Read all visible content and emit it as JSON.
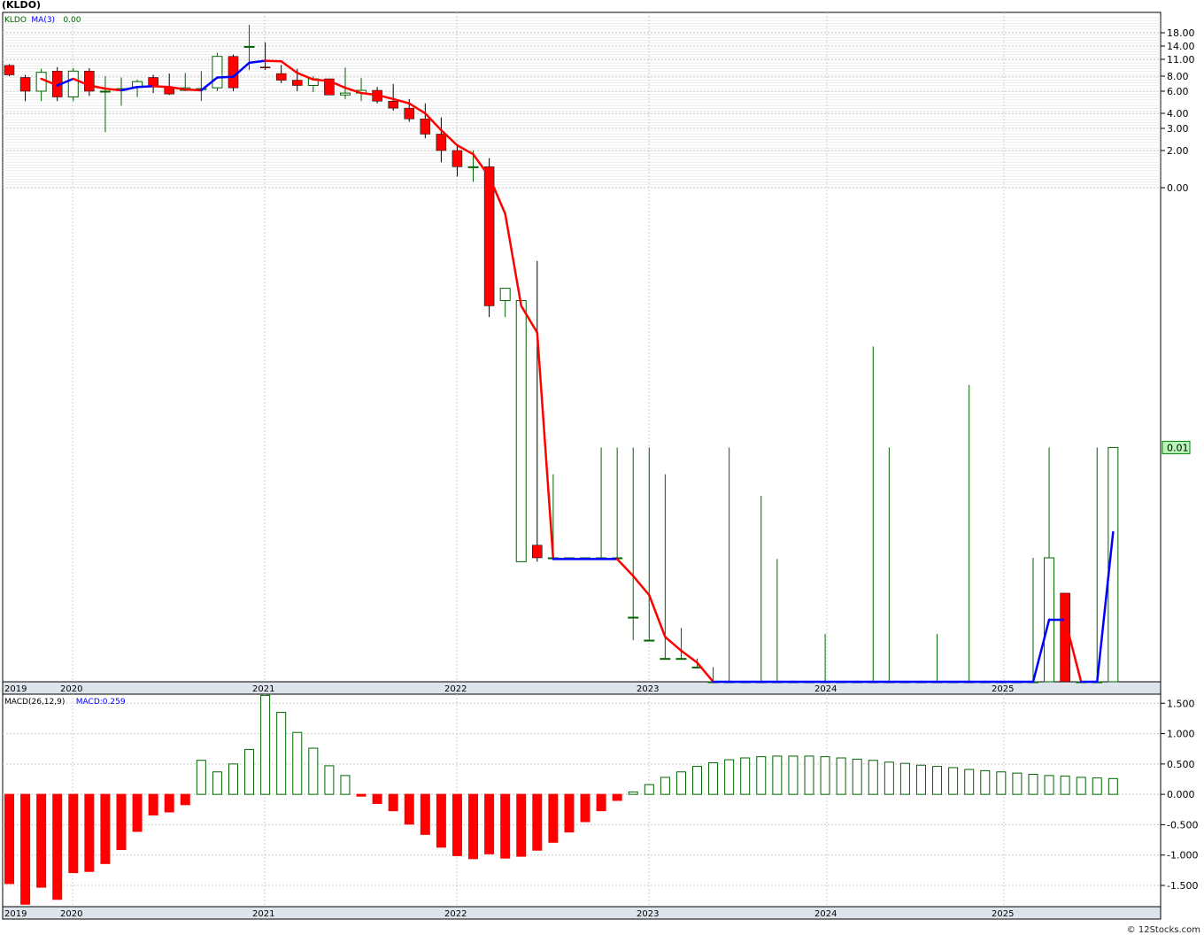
{
  "title": "(KLDO)",
  "credit": "© 12Stocks.com",
  "colors": {
    "up": "#006400",
    "down": "#ff0000",
    "ma_up": "#0000ff",
    "ma_down": "#ff0000",
    "grid": "#cccccc",
    "axis_band": "#dde4ec",
    "last_price_bg": "#b8f5b8"
  },
  "chart_data": [
    {
      "type": "candlestick",
      "name": "price",
      "legend": [
        {
          "label": "KLDO",
          "color": "#006400"
        },
        {
          "label": "MA(3)",
          "color": "#0000ff"
        },
        {
          "label": "0.00",
          "color": "#006400"
        }
      ],
      "scale": "log",
      "y_ticks": [
        "18.00",
        "14.00",
        "11.00",
        "8.00",
        "6.00",
        "4.00",
        "3.00",
        "2.00",
        "0.00"
      ],
      "last_price_label": "0.01",
      "x_tick_labels": [
        "2019",
        "2020",
        "2021",
        "2022",
        "2023",
        "2024",
        "2025"
      ],
      "months": [
        "2019-11",
        "2019-12",
        "2020-01",
        "2020-02",
        "2020-03",
        "2020-04",
        "2020-05",
        "2020-06",
        "2020-07",
        "2020-08",
        "2020-09",
        "2020-10",
        "2020-11",
        "2020-12",
        "2021-01",
        "2021-02",
        "2021-03",
        "2021-04",
        "2021-05",
        "2021-06",
        "2021-07",
        "2021-08",
        "2021-09",
        "2021-10",
        "2021-11",
        "2021-12",
        "2022-01",
        "2022-02",
        "2022-03",
        "2022-04",
        "2022-05",
        "2022-06",
        "2022-07",
        "2022-08",
        "2022-09",
        "2022-10",
        "2022-11",
        "2022-12",
        "2023-01",
        "2023-02",
        "2023-03",
        "2023-04",
        "2023-05",
        "2023-06",
        "2023-07",
        "2023-08",
        "2023-09",
        "2023-10",
        "2023-11",
        "2023-12",
        "2024-01",
        "2024-02",
        "2024-03",
        "2024-04",
        "2024-05",
        "2024-06",
        "2024-07",
        "2024-08",
        "2024-09",
        "2024-10",
        "2024-11",
        "2024-12",
        "2025-01",
        "2025-02",
        "2025-03",
        "2025-04",
        "2025-05",
        "2025-06",
        "2025-07",
        "2025-08"
      ],
      "open": [
        9.8,
        7.8,
        6.0,
        8.8,
        5.4,
        8.8,
        6.0,
        6.1,
        6.5,
        7.8,
        6.5,
        6.1,
        6.3,
        6.4,
        11.6,
        13.9,
        9.5,
        8.4,
        7.4,
        6.7,
        7.6,
        5.6,
        5.8,
        6.1,
        5.0,
        4.4,
        3.6,
        2.7,
        2.0,
        1.6,
        1.6,
        0.5,
        0.065,
        0.075,
        0.068,
        0.068,
        0.068,
        0.068,
        0.068,
        0.034,
        0.026,
        0.021,
        0.021,
        0.019,
        0.016,
        0.016,
        0.016,
        0.016,
        0.016,
        0.016,
        0.016,
        0.016,
        0.016,
        0.016,
        0.016,
        0.016,
        0.016,
        0.016,
        0.016,
        0.016,
        0.016,
        0.016,
        0.016,
        0.016,
        0.016,
        0.016,
        0.045,
        0.016,
        0.016,
        0.016
      ],
      "high": [
        10.0,
        8.2,
        9.2,
        9.5,
        9.3,
        9.3,
        8.0,
        7.8,
        7.5,
        8.2,
        8.4,
        8.5,
        8.8,
        12.4,
        12.0,
        20.0,
        15.0,
        9.9,
        9.2,
        8.0,
        7.5,
        9.4,
        7.7,
        6.5,
        6.9,
        5.2,
        4.8,
        3.7,
        2.2,
        2.0,
        1.8,
        0.55,
        0.48,
        0.68,
        0.13,
        0.068,
        0.068,
        0.16,
        0.16,
        0.16,
        0.16,
        0.13,
        0.03,
        0.021,
        0.019,
        0.16,
        0.016,
        0.11,
        0.067,
        0.016,
        0.016,
        0.028,
        0.016,
        0.016,
        0.35,
        0.16,
        0.016,
        0.016,
        0.028,
        0.016,
        0.26,
        0.016,
        0.016,
        0.016,
        0.068,
        0.16,
        0.045,
        0.016,
        0.16,
        0.16
      ],
      "low": [
        8.0,
        5.0,
        5.0,
        5.0,
        5.0,
        5.5,
        2.8,
        4.6,
        5.4,
        5.8,
        5.6,
        6.0,
        5.0,
        6.0,
        6.0,
        9.0,
        9.0,
        7.0,
        6.0,
        5.9,
        5.6,
        5.2,
        5.0,
        4.8,
        4.2,
        3.4,
        2.5,
        1.7,
        1.4,
        1.3,
        0.44,
        0.44,
        0.065,
        0.065,
        0.068,
        0.068,
        0.068,
        0.068,
        0.068,
        0.026,
        0.026,
        0.021,
        0.021,
        0.019,
        0.016,
        0.016,
        0.016,
        0.016,
        0.016,
        0.016,
        0.016,
        0.016,
        0.016,
        0.016,
        0.016,
        0.016,
        0.016,
        0.016,
        0.016,
        0.016,
        0.016,
        0.016,
        0.016,
        0.016,
        0.016,
        0.016,
        0.016,
        0.016,
        0.016,
        0.016
      ],
      "close": [
        8.2,
        6.0,
        8.6,
        5.4,
        8.8,
        6.0,
        6.0,
        6.3,
        7.2,
        6.5,
        5.7,
        6.4,
        6.3,
        11.6,
        6.4,
        13.9,
        9.4,
        7.4,
        6.7,
        7.6,
        5.6,
        5.8,
        6.1,
        5.0,
        4.4,
        3.6,
        2.7,
        2.0,
        1.6,
        1.6,
        0.48,
        0.55,
        0.5,
        0.068,
        0.068,
        0.068,
        0.068,
        0.068,
        0.068,
        0.034,
        0.026,
        0.021,
        0.021,
        0.019,
        0.016,
        0.016,
        0.016,
        0.016,
        0.016,
        0.016,
        0.016,
        0.016,
        0.016,
        0.016,
        0.016,
        0.016,
        0.016,
        0.016,
        0.016,
        0.016,
        0.016,
        0.016,
        0.016,
        0.016,
        0.016,
        0.068,
        0.016,
        0.016,
        0.016,
        0.16
      ],
      "ma3": [
        null,
        null,
        7.6,
        6.7,
        7.6,
        6.7,
        6.3,
        6.1,
        6.5,
        6.6,
        6.5,
        6.2,
        6.1,
        7.8,
        7.9,
        10.3,
        10.7,
        10.6,
        8.5,
        7.5,
        7.3,
        6.4,
        5.8,
        5.6,
        5.2,
        4.8,
        4.0,
        2.9,
        2.2,
        1.9,
        1.4,
        0.98,
        0.48,
        0.39,
        0.067,
        0.067,
        0.067,
        0.067,
        0.067,
        0.055,
        0.044,
        0.027,
        0.023,
        0.02,
        0.016,
        0.016,
        0.016,
        0.016,
        0.016,
        0.016,
        0.016,
        0.016,
        0.016,
        0.016,
        0.016,
        0.016,
        0.016,
        0.016,
        0.016,
        0.016,
        0.016,
        0.016,
        0.016,
        0.016,
        0.016,
        0.033,
        0.033,
        0.016,
        0.016,
        0.083
      ]
    },
    {
      "type": "bar",
      "name": "macd",
      "legend": [
        {
          "label": "MACD(26,12,9)",
          "color": "#000000"
        },
        {
          "label": "MACD:0.259",
          "color": "#0000ff"
        }
      ],
      "y_ticks": [
        "1.500",
        "1.000",
        "0.500",
        "0.000",
        "-0.500",
        "-1.000",
        "-1.500"
      ],
      "ylim": [
        -1.85,
        1.65
      ],
      "x_tick_labels": [
        "2019",
        "2020",
        "2021",
        "2022",
        "2023",
        "2024",
        "2025"
      ],
      "values": [
        -1.47,
        -1.81,
        -1.53,
        -1.73,
        -1.29,
        -1.27,
        -1.14,
        -0.91,
        -0.61,
        -0.34,
        -0.29,
        -0.17,
        0.56,
        0.37,
        0.5,
        0.74,
        1.63,
        1.35,
        1.02,
        0.76,
        0.47,
        0.31,
        -0.03,
        -0.15,
        -0.27,
        -0.49,
        -0.66,
        -0.87,
        -1.01,
        -1.06,
        -0.98,
        -1.05,
        -1.02,
        -0.92,
        -0.79,
        -0.62,
        -0.45,
        -0.27,
        -0.1,
        0.04,
        0.16,
        0.28,
        0.37,
        0.46,
        0.52,
        0.57,
        0.6,
        0.62,
        0.63,
        0.63,
        0.63,
        0.62,
        0.6,
        0.58,
        0.56,
        0.53,
        0.51,
        0.48,
        0.46,
        0.44,
        0.41,
        0.39,
        0.37,
        0.35,
        0.33,
        0.31,
        0.3,
        0.28,
        0.27,
        0.26
      ]
    }
  ]
}
